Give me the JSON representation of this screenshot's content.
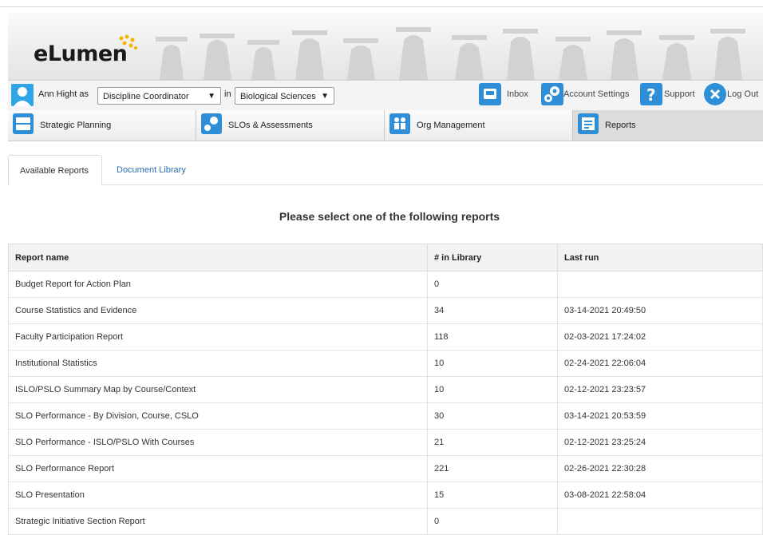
{
  "app": {
    "logo_text": "eLumen"
  },
  "userbar": {
    "user_name": "Ann Hight as",
    "role_select": "Discipline Coordinator",
    "in_text": "in",
    "dept_select": "Biological Sciences",
    "inbox_label": "Inbox",
    "account_label": "Account Settings",
    "support_label": "Support",
    "logout_label": "Log Out"
  },
  "nav": {
    "items": [
      {
        "label": "Strategic Planning",
        "icon": "strategic-planning-icon"
      },
      {
        "label": "SLOs & Assessments",
        "icon": "slo-icon"
      },
      {
        "label": "Org Management",
        "icon": "org-people-icon"
      },
      {
        "label": "Reports",
        "icon": "reports-icon"
      }
    ]
  },
  "tabs": [
    {
      "label": "Available Reports"
    },
    {
      "label": "Document Library"
    }
  ],
  "main": {
    "heading": "Please select one of the following reports"
  },
  "table": {
    "headers": [
      "Report name",
      "# in Library",
      "Last run"
    ],
    "rows": [
      [
        "Budget Report for Action Plan",
        "0",
        ""
      ],
      [
        "Course Statistics and Evidence",
        "34",
        "03-14-2021 20:49:50"
      ],
      [
        "Faculty Participation Report",
        "118",
        "02-03-2021 17:24:02"
      ],
      [
        "Institutional Statistics",
        "10",
        "02-24-2021 22:06:04"
      ],
      [
        "ISLO/PSLO Summary Map by Course/Context",
        "10",
        "02-12-2021 23:23:57"
      ],
      [
        "SLO Performance - By Division, Course, CSLO",
        "30",
        "03-14-2021 20:53:59"
      ],
      [
        "SLO Performance - ISLO/PSLO With Courses",
        "21",
        "02-12-2021 23:25:24"
      ],
      [
        "SLO Performance Report",
        "221",
        "02-26-2021 22:30:28"
      ],
      [
        "SLO Presentation",
        "15",
        "03-08-2021 22:58:04"
      ],
      [
        "Strategic Initiative Section Report",
        "0",
        ""
      ]
    ]
  },
  "colors": {
    "accent_blue": "#2e8fd8",
    "link": "#2a6fb0",
    "logo_dot": "#f5b400"
  }
}
